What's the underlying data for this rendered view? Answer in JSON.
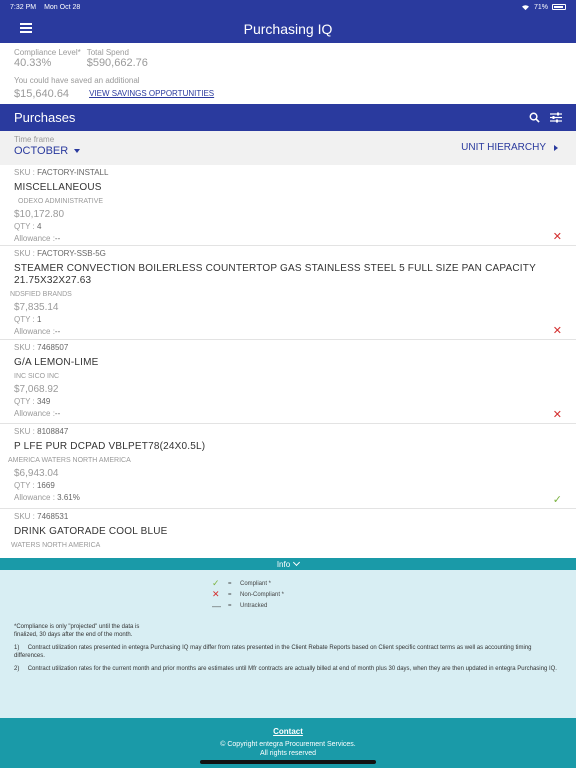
{
  "status_bar": {
    "time": "7:32 PM",
    "date": "Mon Oct 28",
    "battery": "71%"
  },
  "app": {
    "title": "Purchasing IQ"
  },
  "summary": {
    "compliance_label": "Compliance Level*",
    "compliance_value": "40.33%",
    "spend_label": "Total Spend",
    "spend_value": "$590,662.76",
    "savings_label": "You could have saved an additional",
    "savings_value": "$15,640.64",
    "savings_link": "VIEW SAVINGS OPPORTUNITIES"
  },
  "purchases": {
    "title": "Purchases"
  },
  "filter": {
    "timeframe_label": "Time frame",
    "timeframe_value": "OCTOBER",
    "unit_hierarchy": "UNIT HIERARCHY"
  },
  "labels": {
    "sku": "SKU :",
    "qty": "QTY :",
    "allowance": "Allowance :"
  },
  "items": [
    {
      "sku": "FACTORY-INSTALL",
      "name": "MISCELLANEOUS",
      "vendor": "ODEXO ADMINISTRATIVE",
      "price": "$10,172.80",
      "qty": "4",
      "allowance": "--",
      "status": "non-compliant"
    },
    {
      "sku": "FACTORY-SSB-5G",
      "name": "STEAMER CONVECTION BOILERLESS COUNTERTOP GAS STAINLESS STEEL 5 FULL SIZE PAN CAPACITY 21.75X32X27.63",
      "vendor": "NDSFIED BRANDS",
      "price": "$7,835.14",
      "qty": "1",
      "allowance": "--",
      "status": "non-compliant"
    },
    {
      "sku": "7468507",
      "name": "G/A LEMON-LIME",
      "vendor": "INC SICO INC",
      "price": "$7,068.92",
      "qty": "349",
      "allowance": "--",
      "status": "non-compliant"
    },
    {
      "sku": "8108847",
      "name": "P LFE PUR DCPAD VBLPET78(24X0.5L)",
      "vendor": "AMERICA WATERS NORTH AMERICA",
      "price": "$6,943.04",
      "qty": "1669",
      "allowance": "3.61%",
      "status": "compliant"
    },
    {
      "sku": "7468531",
      "name": "DRINK GATORADE COOL BLUE",
      "vendor": "WATERS NORTH AMERICA",
      "price": "",
      "qty": "",
      "allowance": "",
      "status": ""
    }
  ],
  "info": {
    "toggle_label": "Info",
    "legend": [
      {
        "symbol": "✓",
        "label": "Compliant *",
        "color": "#7cb342"
      },
      {
        "symbol": "✕",
        "label": "Non-Compliant *",
        "color": "#d42d2d"
      },
      {
        "symbol": "—",
        "label": "Untracked",
        "color": "#555555"
      }
    ],
    "legend_eq": "=",
    "note_compliance": "*Compliance is only \"projected\" until the data is finalized, 30 days after the end of the month.",
    "note_1_num": "1)",
    "note_1": "Contract utilization rates presented in entegra Purchasing IQ may differ from rates presented in the Client Rebate Reports based on Client specific contract terms as well as accounting timing differences.",
    "note_2_num": "2)",
    "note_2": "Contract utilization rates for the current month and prior months are estimates until Mfr contracts are actually billed at end of month plus 30 days, when they are then updated in entegra Purchasing IQ."
  },
  "footer": {
    "contact": "Contact",
    "copyright_1": "© Copyright entegra Procurement Services.",
    "copyright_2": "All rights reserved"
  },
  "colors": {
    "primary": "#2a3a9e",
    "teal": "#1a9aa8",
    "panel": "#d8eef3",
    "error": "#d42d2d",
    "success": "#7cb342"
  }
}
